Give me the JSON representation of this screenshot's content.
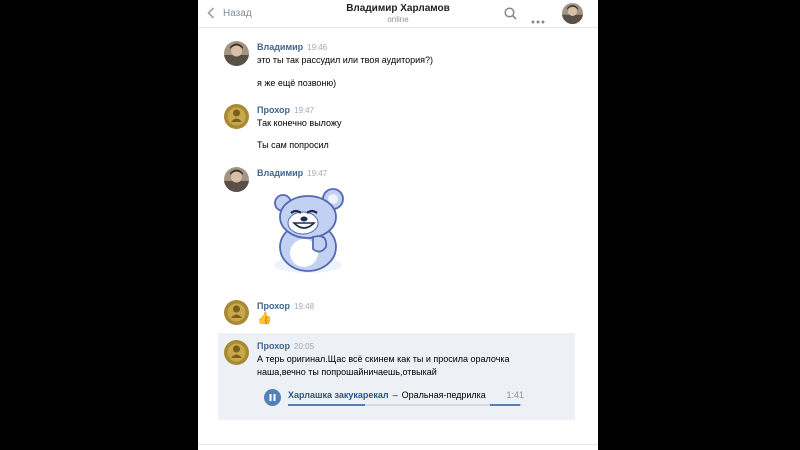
{
  "header": {
    "back_label": "Назад",
    "title": "Владимир Харламов",
    "status": "online"
  },
  "messages": [
    {
      "author": "Владимир",
      "time": "19:46",
      "lines": [
        "это ты так рассудил или твоя аудитория?)",
        "я же ещё позвоню)"
      ]
    },
    {
      "author": "Прохор",
      "time": "19:47",
      "lines": [
        "Так конечно выложу",
        "Ты сам попросил"
      ]
    },
    {
      "author": "Владимир",
      "time": "19:47",
      "sticker": "bear-sticker"
    },
    {
      "author": "Прохор",
      "time": "19:48",
      "emoji": "👍"
    },
    {
      "author": "Прохор",
      "time": "20:05",
      "lines": [
        "А терь оригинал.Щас всё скинем как ты и просила оралочка",
        "наша,вечно ты попрошайничаешь,отвыкай"
      ],
      "audio": {
        "artist": "Харлашка закукарекал",
        "separator": "–",
        "title": "Оральная-педрилка",
        "duration": "1:41",
        "progress": 0.33,
        "state": "playing"
      }
    }
  ],
  "colors": {
    "link": "#42648b",
    "accent": "#5181b8",
    "highlight": "#edf0f5"
  }
}
